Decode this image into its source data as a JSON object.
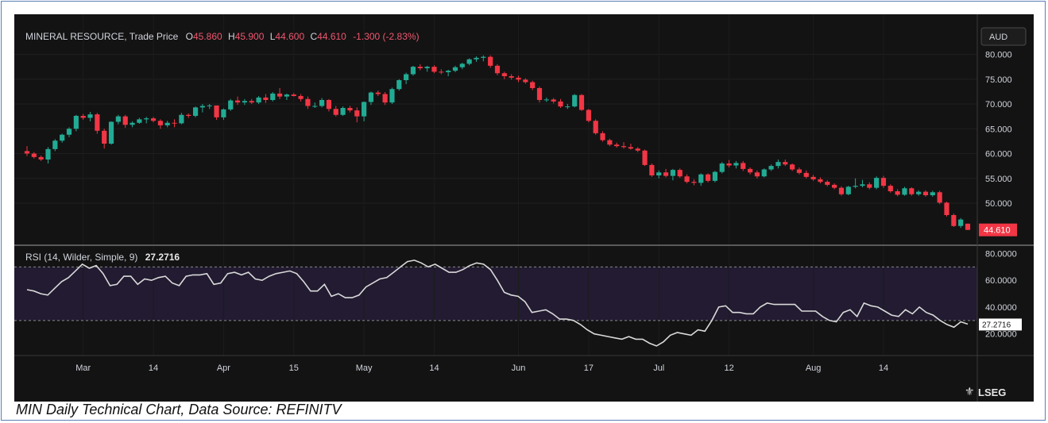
{
  "chart_data": {
    "type": "candlestick",
    "title": "MINERAL RESOURCE, Trade Price",
    "ohlc_labels": {
      "o_key": "O",
      "o": "45.860",
      "h_key": "H",
      "h": "45.900",
      "l_key": "L",
      "l": "44.600",
      "c_key": "C",
      "c": "44.610",
      "change": "-1.300 (-2.83%)"
    },
    "currency": "AUD",
    "last_price_label": "44.610",
    "price_ylim": [
      42,
      82
    ],
    "price_ticks": [
      "80.000",
      "75.000",
      "70.000",
      "65.000",
      "60.000",
      "55.000",
      "50.000"
    ],
    "x_ticks": [
      {
        "i": 8,
        "label": "Mar"
      },
      {
        "i": 18,
        "label": "14"
      },
      {
        "i": 28,
        "label": "Apr"
      },
      {
        "i": 38,
        "label": "15"
      },
      {
        "i": 48,
        "label": "May"
      },
      {
        "i": 58,
        "label": "14"
      },
      {
        "i": 70,
        "label": "Jun"
      },
      {
        "i": 80,
        "label": "17"
      },
      {
        "i": 90,
        "label": "Jul"
      },
      {
        "i": 100,
        "label": "12"
      },
      {
        "i": 112,
        "label": "Aug"
      },
      {
        "i": 122,
        "label": "14"
      }
    ],
    "candles": [
      [
        60.5,
        61.5,
        59.5,
        60.0
      ],
      [
        60.0,
        60.3,
        59.0,
        59.3
      ],
      [
        59.3,
        59.6,
        58.5,
        58.8
      ],
      [
        58.8,
        61.3,
        58.0,
        60.9
      ],
      [
        60.9,
        62.9,
        60.5,
        62.6
      ],
      [
        62.6,
        64.0,
        62.2,
        63.8
      ],
      [
        63.8,
        65.3,
        63.3,
        65.0
      ],
      [
        65.0,
        67.8,
        64.5,
        67.6
      ],
      [
        67.6,
        68.0,
        66.8,
        67.2
      ],
      [
        67.2,
        68.4,
        66.5,
        67.9
      ],
      [
        67.9,
        68.2,
        64.0,
        64.6
      ],
      [
        64.6,
        65.0,
        61.0,
        62.0
      ],
      [
        62.0,
        66.5,
        61.8,
        66.4
      ],
      [
        66.4,
        67.8,
        65.9,
        67.5
      ],
      [
        67.5,
        67.8,
        65.2,
        65.8
      ],
      [
        65.8,
        66.5,
        65.3,
        66.2
      ],
      [
        66.2,
        67.2,
        66.0,
        66.9
      ],
      [
        66.9,
        67.4,
        66.1,
        67.1
      ],
      [
        67.1,
        67.4,
        66.3,
        66.6
      ],
      [
        66.6,
        66.9,
        65.0,
        65.7
      ],
      [
        65.7,
        66.6,
        65.3,
        66.2
      ],
      [
        66.2,
        66.9,
        65.3,
        66.1
      ],
      [
        66.1,
        68.2,
        65.9,
        67.8
      ],
      [
        67.8,
        68.1,
        67.2,
        67.6
      ],
      [
        67.6,
        69.5,
        67.3,
        69.3
      ],
      [
        69.3,
        70.0,
        68.3,
        69.6
      ],
      [
        69.6,
        70.0,
        69.0,
        69.7
      ],
      [
        69.7,
        68.9,
        66.8,
        67.3
      ],
      [
        67.3,
        69.1,
        66.8,
        68.9
      ],
      [
        68.9,
        71.0,
        68.6,
        70.7
      ],
      [
        70.7,
        71.5,
        69.8,
        70.3
      ],
      [
        70.3,
        71.0,
        69.8,
        70.6
      ],
      [
        70.6,
        71.0,
        70.0,
        70.3
      ],
      [
        70.3,
        71.6,
        70.0,
        71.3
      ],
      [
        71.3,
        72.0,
        70.2,
        70.8
      ],
      [
        70.8,
        72.4,
        70.5,
        72.1
      ],
      [
        72.1,
        73.2,
        71.0,
        71.5
      ],
      [
        71.5,
        72.1,
        70.8,
        71.9
      ],
      [
        71.9,
        72.2,
        71.5,
        71.6
      ],
      [
        71.6,
        72.0,
        70.5,
        71.0
      ],
      [
        71.0,
        71.5,
        69.0,
        69.6
      ],
      [
        69.6,
        70.3,
        69.2,
        69.6
      ],
      [
        69.6,
        71.2,
        69.3,
        70.8
      ],
      [
        70.8,
        71.0,
        68.5,
        69.0
      ],
      [
        69.0,
        69.6,
        67.5,
        67.8
      ],
      [
        67.8,
        69.5,
        67.6,
        69.2
      ],
      [
        69.2,
        69.6,
        68.3,
        68.7
      ],
      [
        68.7,
        69.3,
        66.3,
        67.5
      ],
      [
        67.5,
        70.5,
        66.5,
        70.4
      ],
      [
        70.4,
        72.5,
        69.8,
        72.3
      ],
      [
        72.3,
        72.7,
        71.6,
        72.0
      ],
      [
        72.0,
        72.4,
        69.8,
        70.3
      ],
      [
        70.3,
        73.3,
        70.0,
        73.0
      ],
      [
        73.0,
        75.0,
        72.7,
        74.8
      ],
      [
        74.8,
        76.3,
        74.0,
        76.0
      ],
      [
        76.0,
        77.7,
        75.7,
        77.5
      ],
      [
        77.5,
        78.0,
        76.8,
        77.2
      ],
      [
        77.2,
        77.7,
        76.5,
        77.5
      ],
      [
        77.5,
        77.8,
        76.2,
        76.5
      ],
      [
        76.5,
        77.0,
        76.0,
        76.4
      ],
      [
        76.4,
        76.9,
        75.6,
        76.7
      ],
      [
        76.7,
        77.7,
        76.4,
        77.4
      ],
      [
        77.4,
        78.3,
        77.0,
        78.1
      ],
      [
        78.1,
        79.2,
        77.8,
        79.0
      ],
      [
        79.0,
        79.6,
        78.5,
        79.3
      ],
      [
        79.3,
        79.8,
        78.6,
        79.5
      ],
      [
        79.5,
        79.8,
        77.3,
        77.7
      ],
      [
        77.7,
        78.0,
        75.8,
        76.2
      ],
      [
        76.2,
        76.5,
        75.0,
        75.6
      ],
      [
        75.6,
        76.0,
        74.9,
        75.3
      ],
      [
        75.3,
        75.7,
        74.4,
        74.9
      ],
      [
        74.9,
        75.2,
        74.1,
        74.4
      ],
      [
        74.4,
        74.7,
        72.8,
        73.2
      ],
      [
        73.2,
        73.5,
        70.3,
        70.8
      ],
      [
        70.8,
        71.3,
        70.4,
        70.9
      ],
      [
        70.9,
        71.2,
        70.1,
        70.5
      ],
      [
        70.5,
        71.0,
        69.2,
        69.5
      ],
      [
        69.5,
        70.0,
        69.0,
        69.5
      ],
      [
        69.5,
        72.0,
        69.3,
        71.8
      ],
      [
        71.8,
        72.0,
        68.6,
        68.8
      ],
      [
        68.8,
        69.0,
        66.3,
        66.6
      ],
      [
        66.6,
        66.9,
        63.8,
        64.1
      ],
      [
        64.1,
        64.5,
        62.4,
        62.7
      ],
      [
        62.7,
        63.0,
        61.5,
        61.8
      ],
      [
        61.8,
        62.2,
        61.2,
        61.5
      ],
      [
        61.5,
        62.3,
        61.0,
        61.3
      ],
      [
        61.3,
        62.0,
        60.8,
        61.0
      ],
      [
        61.0,
        61.3,
        60.3,
        60.6
      ],
      [
        60.6,
        60.8,
        57.5,
        57.7
      ],
      [
        57.7,
        58.0,
        55.3,
        55.6
      ],
      [
        55.6,
        56.6,
        55.0,
        56.2
      ],
      [
        56.2,
        56.9,
        55.2,
        55.5
      ],
      [
        55.5,
        56.9,
        54.6,
        56.7
      ],
      [
        56.7,
        57.0,
        55.1,
        55.4
      ],
      [
        55.4,
        55.8,
        54.0,
        54.3
      ],
      [
        54.3,
        54.8,
        53.6,
        54.1
      ],
      [
        54.1,
        56.0,
        53.5,
        55.8
      ],
      [
        55.8,
        56.0,
        54.2,
        54.5
      ],
      [
        54.5,
        56.5,
        54.2,
        56.3
      ],
      [
        56.3,
        58.3,
        56.0,
        58.0
      ],
      [
        58.0,
        58.7,
        57.2,
        57.6
      ],
      [
        57.6,
        58.5,
        57.0,
        58.1
      ],
      [
        58.1,
        58.5,
        56.5,
        56.9
      ],
      [
        56.9,
        57.2,
        55.8,
        56.2
      ],
      [
        56.2,
        56.6,
        55.0,
        55.4
      ],
      [
        55.4,
        57.0,
        55.2,
        56.8
      ],
      [
        56.8,
        57.8,
        56.5,
        57.5
      ],
      [
        57.5,
        58.8,
        57.0,
        58.3
      ],
      [
        58.3,
        58.8,
        57.5,
        57.8
      ],
      [
        57.8,
        58.0,
        56.5,
        56.8
      ],
      [
        56.8,
        57.2,
        55.8,
        56.1
      ],
      [
        56.1,
        56.6,
        55.0,
        55.3
      ],
      [
        55.3,
        55.7,
        54.5,
        54.8
      ],
      [
        54.8,
        55.2,
        54.0,
        54.3
      ],
      [
        54.3,
        54.6,
        53.4,
        53.7
      ],
      [
        53.7,
        54.0,
        52.8,
        53.1
      ],
      [
        53.1,
        53.4,
        51.5,
        51.8
      ],
      [
        51.8,
        53.5,
        51.6,
        53.3
      ],
      [
        53.3,
        55.0,
        53.0,
        53.5
      ],
      [
        53.5,
        54.7,
        53.2,
        53.8
      ],
      [
        53.8,
        54.2,
        52.8,
        53.1
      ],
      [
        53.1,
        55.4,
        52.8,
        55.1
      ],
      [
        55.1,
        55.5,
        53.1,
        53.5
      ],
      [
        53.5,
        53.8,
        52.1,
        52.4
      ],
      [
        52.4,
        52.8,
        51.4,
        51.7
      ],
      [
        51.7,
        53.3,
        51.5,
        53.0
      ],
      [
        53.0,
        53.2,
        51.5,
        51.8
      ],
      [
        51.8,
        52.6,
        51.5,
        52.3
      ],
      [
        52.3,
        52.6,
        51.3,
        51.6
      ],
      [
        51.6,
        52.5,
        51.3,
        52.2
      ],
      [
        52.2,
        52.5,
        49.8,
        50.1
      ],
      [
        50.1,
        50.3,
        47.3,
        47.6
      ],
      [
        47.6,
        47.9,
        45.2,
        45.4
      ],
      [
        45.4,
        47.0,
        45.0,
        46.7
      ],
      [
        45.86,
        45.9,
        44.6,
        44.61
      ]
    ],
    "rsi_label": "RSI (14, Wilder, Simple, 9)",
    "rsi_value_label": "27.2716",
    "rsi_ylim": [
      5,
      85
    ],
    "rsi_ticks": [
      "80.0000",
      "60.0000",
      "40.0000",
      "20.0000"
    ],
    "rsi_bands": [
      30,
      70
    ],
    "rsi_values": [
      53,
      52,
      50,
      49,
      54,
      59,
      62,
      67,
      72,
      69,
      71,
      65,
      56,
      57,
      63,
      63,
      57,
      61,
      60,
      62,
      63,
      58,
      56,
      63,
      64,
      64,
      65,
      57,
      58,
      65,
      66,
      64,
      66,
      61,
      60,
      63,
      65,
      66,
      67,
      65,
      59,
      52,
      52,
      57,
      48,
      50,
      47,
      47,
      49,
      55,
      58,
      61,
      62,
      66,
      70,
      74,
      75,
      73,
      70,
      72,
      69,
      66,
      66,
      68,
      71,
      73,
      72,
      68,
      60,
      51,
      49,
      48,
      44,
      36,
      37,
      38,
      35,
      31,
      31,
      30,
      27,
      23,
      20,
      19,
      18,
      17,
      16,
      18,
      16,
      16,
      13,
      11,
      14,
      19,
      21,
      20,
      19,
      23,
      22,
      30,
      40,
      41,
      36,
      36,
      35,
      35,
      40,
      43,
      42,
      42,
      42,
      42,
      37,
      37,
      37,
      33,
      30,
      29,
      36,
      38,
      33,
      43,
      41,
      40,
      37,
      34,
      33,
      38,
      35,
      40,
      36,
      34,
      30,
      27,
      25,
      29,
      27.27
    ]
  }
}
